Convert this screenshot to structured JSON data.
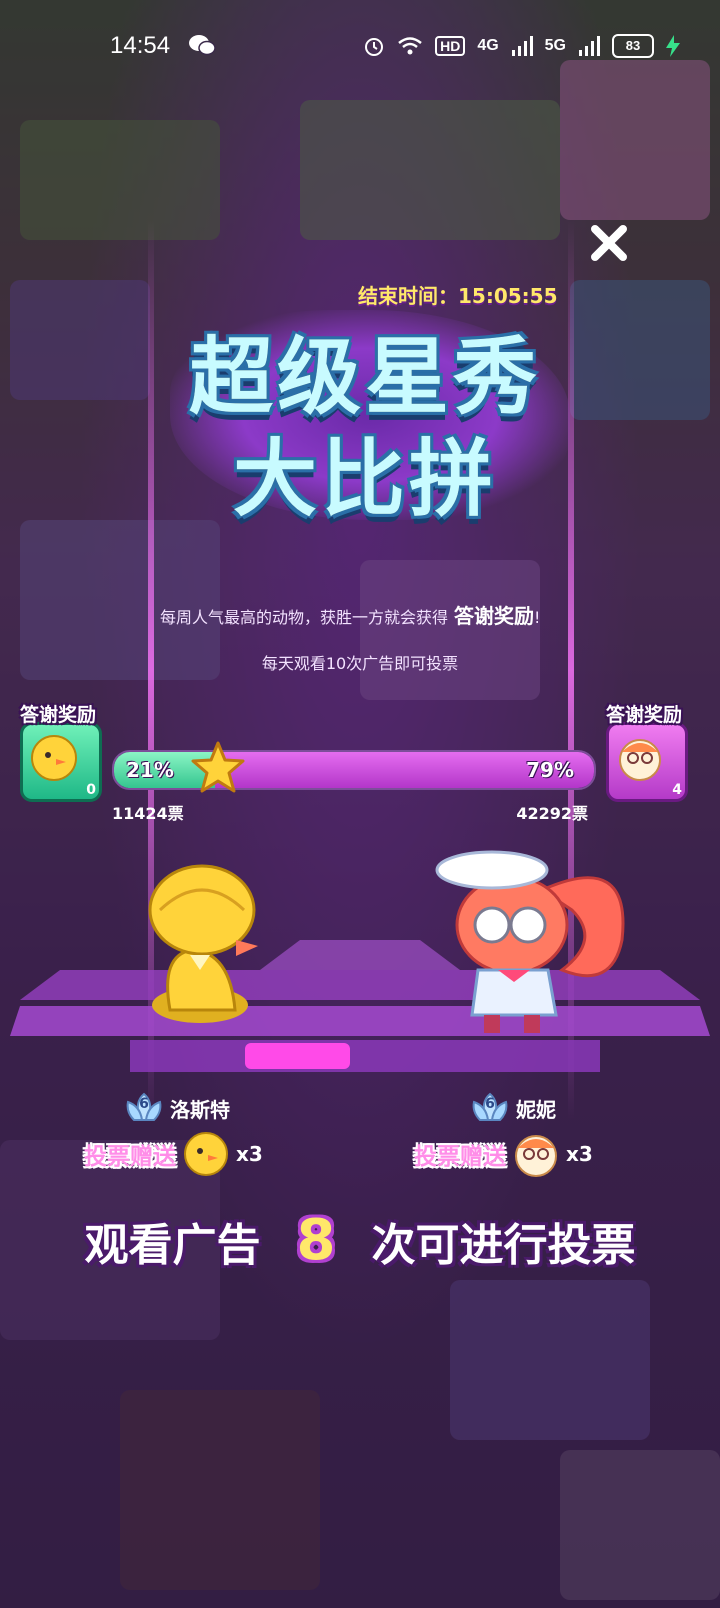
{
  "status_bar": {
    "time": "14:54",
    "wifi_badge": "HD",
    "net1": "4G",
    "net2": "5G",
    "battery": "83"
  },
  "event": {
    "end_time_label": "结束时间：15:05:55",
    "title_line1": "超级星秀",
    "title_line2": "大比拼",
    "desc_main": "每周人气最高的动物，获胜一方就会获得",
    "desc_highlight": "答谢奖励",
    "desc_tail": "!",
    "desc_daily": "每天观看10次广告即可投票"
  },
  "rewards": {
    "left": {
      "label": "答谢奖励",
      "count": "0"
    },
    "right": {
      "label": "答谢奖励",
      "count": "4"
    }
  },
  "poll": {
    "left_percent_label": "21%",
    "right_percent_label": "79%",
    "left_fraction": 0.21,
    "left_votes": "11424票",
    "right_votes": "42292票"
  },
  "contestants": {
    "left": {
      "level": "6",
      "name": "洛斯特",
      "gift_text": "投票赠送",
      "gift_mult": "x3"
    },
    "right": {
      "level": "6",
      "name": "妮妮",
      "gift_text": "投票赠送",
      "gift_mult": "x3"
    }
  },
  "cta": {
    "prefix": "观看广告",
    "count": "8",
    "suffix": "次可进行投票"
  },
  "colors": {
    "accent_purple": "#c43fd8",
    "accent_green": "#34c58f",
    "highlight_yellow": "#ffe86a"
  }
}
